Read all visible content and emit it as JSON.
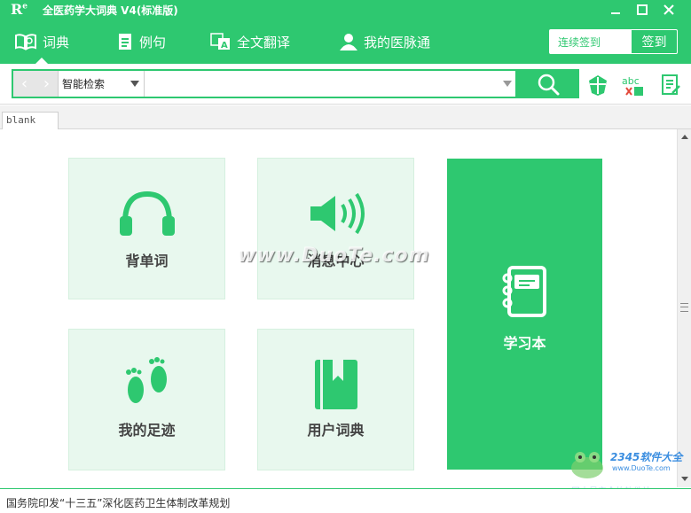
{
  "window": {
    "logo_text": "R",
    "logo_sup": "e",
    "title": "全医药学大词典 V4(标准版)"
  },
  "toolbar": {
    "tabs": [
      {
        "label": "词典",
        "icon": "book-icon",
        "active": true
      },
      {
        "label": "例句",
        "icon": "document-icon",
        "active": false
      },
      {
        "label": "全文翻译",
        "icon": "translate-icon",
        "active": false
      },
      {
        "label": "我的医脉通",
        "icon": "user-icon",
        "active": false
      }
    ],
    "signin_streak": "连续签到",
    "signin_button": "签到"
  },
  "search": {
    "back": "‹",
    "forward": "›",
    "mode": "智能检索",
    "query": "",
    "tools": [
      "shield-icon",
      "spellcheck-icon",
      "notes-icon"
    ]
  },
  "doc_tab": {
    "label": "blank"
  },
  "tiles": [
    {
      "label": "背单词",
      "icon": "headphones-icon"
    },
    {
      "label": "消息中心",
      "icon": "speaker-icon"
    },
    {
      "label": "学习本",
      "icon": "notebook-icon"
    },
    {
      "label": "我的足迹",
      "icon": "footprints-icon"
    },
    {
      "label": "用户词典",
      "icon": "bookmark-book-icon"
    }
  ],
  "watermark": "www.DuoTe.com",
  "status": {
    "text": "国务院印发“十三五”深化医药卫生体制改革规划"
  },
  "corner_watermark": {
    "brand": "2345软件大全",
    "url": "www.DuoTe.com",
    "sub": "国内最安全的软件站"
  },
  "colors": {
    "accent": "#2ec870",
    "tile_bg": "#e8f8ee"
  }
}
